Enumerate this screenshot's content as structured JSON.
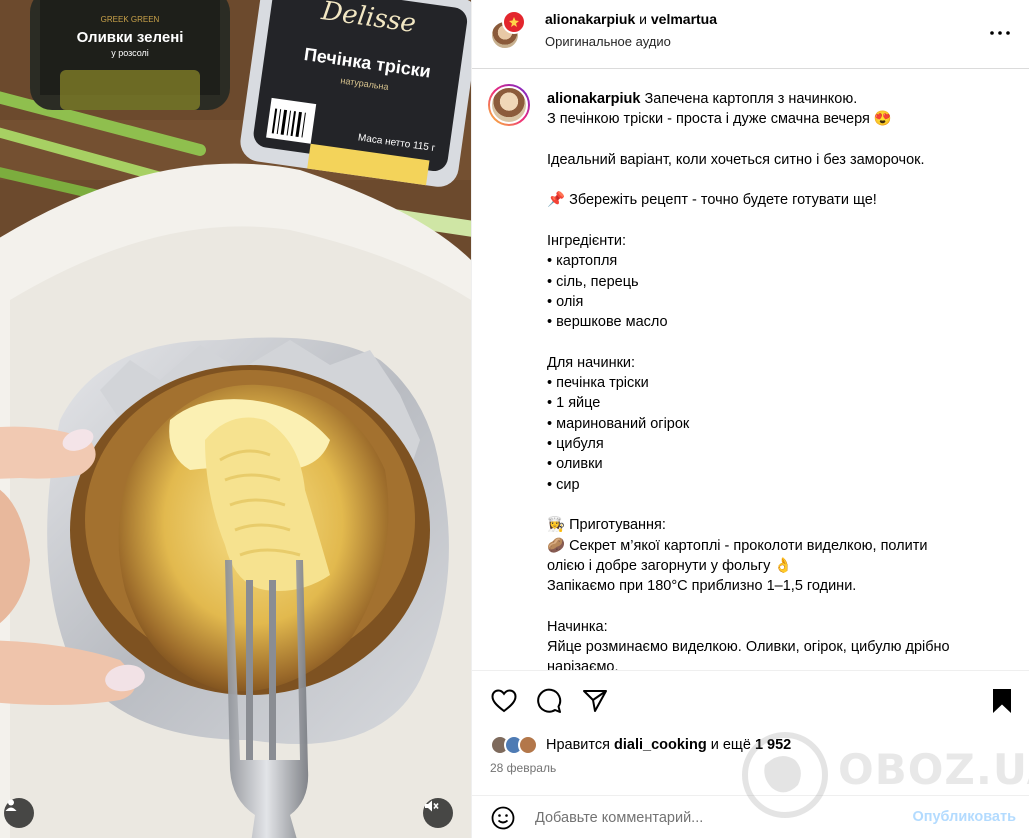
{
  "media": {
    "jar_label": "Оливки зелені",
    "jar_sub_label": "у розсолі",
    "jar_brand_line": "GREEK GREEN",
    "tin_brand": "Delisse",
    "tin_title": "Печінка тріски",
    "tin_sub": "натуральна",
    "tin_weight": "Маса нетто 115 г"
  },
  "header": {
    "user1": "alionakarpiuk",
    "and_text": "и",
    "user2": "velmartua",
    "audio": "Оригинальное аудио"
  },
  "caption": {
    "username": "alionakarpiuk",
    "lines": [
      "Запечена картопля з начинкою.",
      "З печінкою тріски - проста і дуже смачна вечеря 😍",
      "",
      "Ідеальний варіант, коли хочеться ситно і без заморочок.",
      "",
      "📌 Збережіть рецепт - точно будете готувати ще!",
      "",
      "Інгредієнти:",
      "• картопля",
      "• сіль, перець",
      "• олія",
      "• вершкове масло",
      "",
      "Для начинки:",
      "• печінка тріски",
      "• 1 яйце",
      "• маринований огірок",
      "• цибуля",
      "• оливки",
      "• сир",
      "",
      "👩‍🍳 Приготування:",
      "🥔 Секрет м’якої картоплі - проколоти виделкою, полити",
      "олією і добре загорнути у фольгу 👌",
      "Запікаємо при 180°C приблизно 1–1,5 години.",
      "",
      "Начинка:",
      "Яйце розминаємо виделкою. Оливки, огірок, цибулю дрібно",
      "нарізаємо."
    ]
  },
  "likes": {
    "prefix": "Нравится",
    "user": "diali_cooking",
    "suffix": "и ещё",
    "count": "1 952"
  },
  "date": "28 февраль",
  "comment": {
    "placeholder": "Добавьте комментарий...",
    "publish": "Опубликовать"
  },
  "watermark": "OBOZ.UA",
  "colors": {
    "publish": "#b3dbff",
    "gradient_ring": [
      "#f9ce34",
      "#ee2a7b",
      "#6228d7"
    ]
  }
}
